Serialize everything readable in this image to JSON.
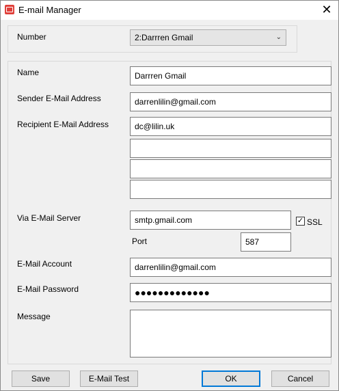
{
  "window": {
    "title": "E-mail Manager",
    "close_glyph": "✕"
  },
  "number": {
    "label": "Number",
    "selected": "2:Darrren Gmail"
  },
  "form": {
    "name_label": "Name",
    "name_value": "Darrren Gmail",
    "sender_label": "Sender E-Mail Address",
    "sender_value": "darrenlilin@gmail.com",
    "recipient_label": "Recipient E-Mail Address",
    "recipients": [
      "dc@lilin.uk",
      "",
      "",
      ""
    ],
    "server_label": "Via E-Mail Server",
    "server_value": "smtp.gmail.com",
    "ssl_label": "SSL",
    "ssl_checked": true,
    "port_label": "Port",
    "port_value": "587",
    "account_label": "E-Mail Account",
    "account_value": "darrenlilin@gmail.com",
    "password_label": "E-Mail Password",
    "password_value": "●●●●●●●●●●●●●",
    "message_label": "Message",
    "message_value": ""
  },
  "buttons": {
    "save": "Save",
    "test": "E-Mail Test",
    "ok": "OK",
    "cancel": "Cancel"
  },
  "icons": {
    "app": "mail-icon",
    "dropdown": "chevron-down-icon",
    "check": "checkmark-icon"
  },
  "colors": {
    "accent": "#0078d7",
    "app_icon": "#e0403a"
  }
}
